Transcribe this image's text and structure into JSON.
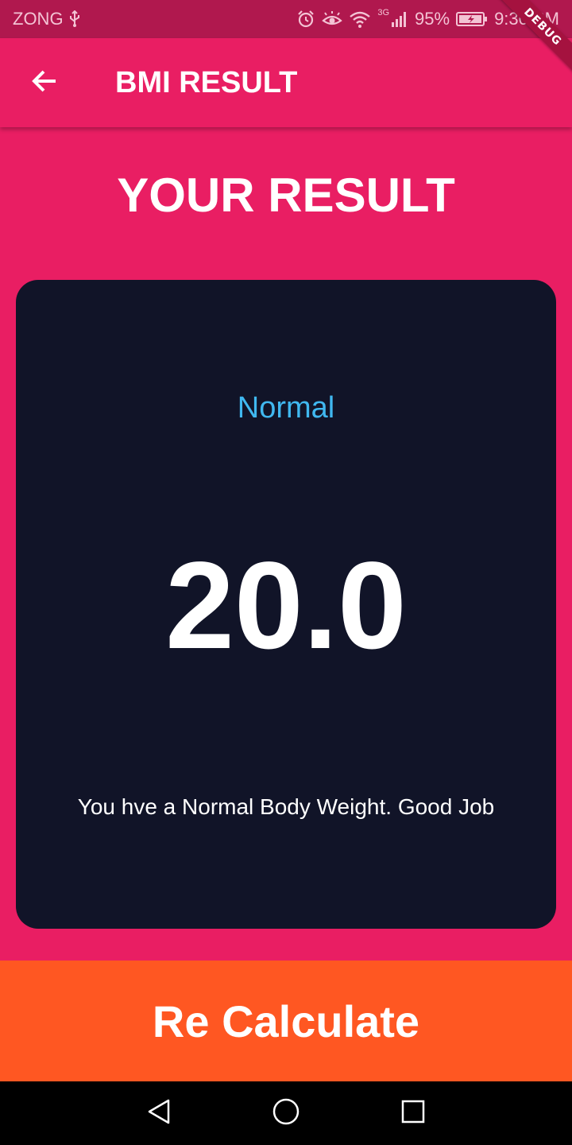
{
  "status_bar": {
    "carrier": "ZONG",
    "network_type": "3G",
    "battery": "95%",
    "time": "9:30 PM",
    "icons": [
      "usb-icon",
      "alarm-icon",
      "eye-comfort-icon",
      "wifi-icon",
      "signal-icon",
      "battery-charging-icon"
    ]
  },
  "debug_banner": "DEBUG",
  "app_bar": {
    "title": "BMI RESULT",
    "back_icon": "arrow-back-icon"
  },
  "result": {
    "heading": "YOUR RESULT",
    "status": "Normal",
    "bmi": "20.0",
    "message": "You hve a Normal Body Weight. Good Job"
  },
  "recalculate": {
    "label": "Re Calculate"
  },
  "nav_bar": {
    "icons": [
      "back-triangle-icon",
      "home-circle-icon",
      "recents-square-icon"
    ]
  },
  "colors": {
    "primary": "#E91E63",
    "status_bar": "#B0184E",
    "card": "#111428",
    "status_text": "#40B8F0",
    "button": "#FF5722",
    "nav_bar": "#000000"
  }
}
